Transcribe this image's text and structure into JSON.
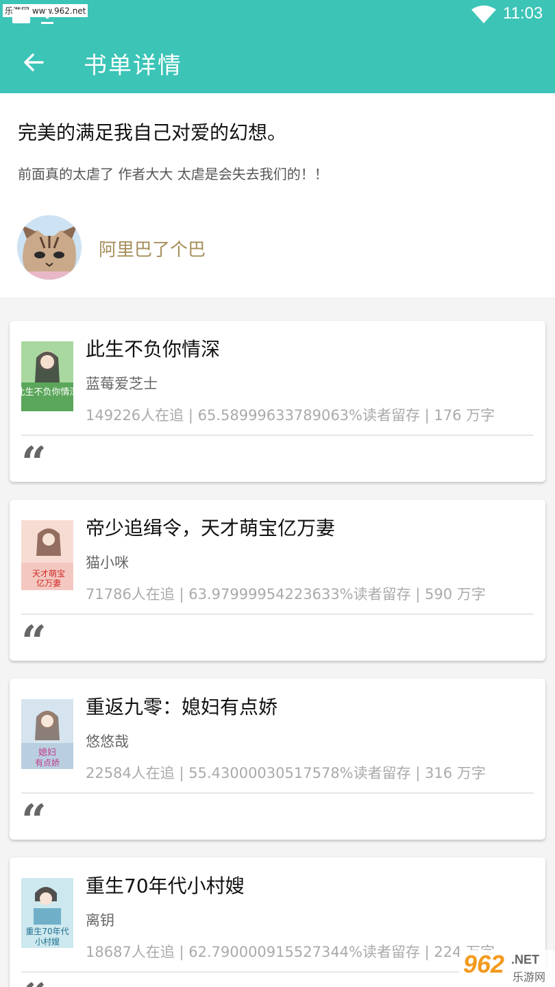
{
  "status_bar": {
    "watermark": "乐游网 www.962.net",
    "time": "11:03"
  },
  "nav": {
    "title": "书单详情"
  },
  "booklist": {
    "title": "完美的满足我自己对爱的幻想。",
    "description": "前面真的太虐了 作者大大 太虐是会失去我们的！！",
    "author_name": "阿里巴了个巴"
  },
  "books": [
    {
      "title": "此生不负你情深",
      "author": "蓝莓爱芝士",
      "stats": "149226人在追 | 65.58999633789063%读者留存 | 176 万字",
      "quote": "“",
      "cover_text": "此生不负你情深",
      "cover_colors": [
        "#a8d8a0",
        "#5aa65a"
      ]
    },
    {
      "title": "帝少追缉令，天才萌宝亿万妻",
      "author": "猫小咪",
      "stats": "71786人在追 | 63.97999954223633%读者留存 | 590 万字",
      "quote": "“",
      "cover_text": "天才萌宝亿万妻",
      "cover_colors": [
        "#f7dcd4",
        "#e05a50"
      ]
    },
    {
      "title": "重返九零：媳妇有点娇",
      "author": "悠悠哉",
      "stats": "22584人在追 | 55.43000030517578%读者留存 | 316 万字",
      "quote": "“",
      "cover_text": "媳妇有点娇",
      "cover_colors": [
        "#d5e4ef",
        "#7fa0c0"
      ]
    },
    {
      "title": "重生70年代小村嫂",
      "author": "离钥",
      "stats": "18687人在追 | 62.790000915527344%读者留存 | 224 万字",
      "quote": "“",
      "cover_text": "重生70年代小村嫂",
      "cover_colors": [
        "#cde8ee",
        "#2f8fae"
      ]
    }
  ],
  "corner_badge": {
    "number": "962",
    "suffix": ".NET",
    "label": "乐游网"
  },
  "colors": {
    "accent": "#3cc4b7",
    "author_name": "#a58e5a"
  }
}
